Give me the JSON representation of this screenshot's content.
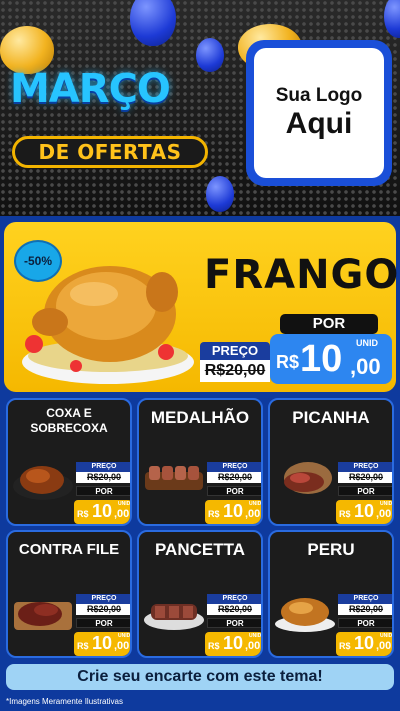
{
  "header": {
    "title_line1": "MARÇO",
    "title_line2": "DE OFERTAS",
    "logo_line1": "Sua Logo",
    "logo_line2": "Aqui"
  },
  "hero": {
    "discount": "-50%",
    "product": "FRANGO",
    "por_label": "POR",
    "preco_label": "PREÇO",
    "old_price": "R$20,00",
    "currency": "R$",
    "price_int": "10",
    "price_dec": ",00",
    "unit": "UNID"
  },
  "products": [
    {
      "name": "COXA E SOBRECOXA",
      "preco_label": "PREÇO",
      "old_price": "R$20,00",
      "por_label": "POR",
      "currency": "R$",
      "price_int": "10",
      "price_dec": ",00",
      "unit": "UNID"
    },
    {
      "name": "MEDALHÃO",
      "preco_label": "PREÇO",
      "old_price": "R$20,00",
      "por_label": "POR",
      "currency": "R$",
      "price_int": "10",
      "price_dec": ",00",
      "unit": "UNID"
    },
    {
      "name": "PICANHA",
      "preco_label": "PREÇO",
      "old_price": "R$20,00",
      "por_label": "POR",
      "currency": "R$",
      "price_int": "10",
      "price_dec": ",00",
      "unit": "UNID"
    },
    {
      "name": "CONTRA FILE",
      "preco_label": "PREÇO",
      "old_price": "R$20,00",
      "por_label": "POR",
      "currency": "R$",
      "price_int": "10",
      "price_dec": ",00",
      "unit": "UNID"
    },
    {
      "name": "PANCETTA",
      "preco_label": "PREÇO",
      "old_price": "R$20,00",
      "por_label": "POR",
      "currency": "R$",
      "price_int": "10",
      "price_dec": ",00",
      "unit": "UNID"
    },
    {
      "name": "PERU",
      "preco_label": "PREÇO",
      "old_price": "R$20,00",
      "por_label": "POR",
      "currency": "R$",
      "price_int": "10",
      "price_dec": ",00",
      "unit": "UNID"
    }
  ],
  "cta": "Crie seu encarte com este tema!",
  "disclaimer": "*Imagens Meramente Ilustrativas",
  "colors": {
    "accent_yellow": "#f5b800",
    "accent_blue": "#2d86f0",
    "dark_card": "#1c1c1c",
    "title_cyan": "#27c4ff"
  }
}
